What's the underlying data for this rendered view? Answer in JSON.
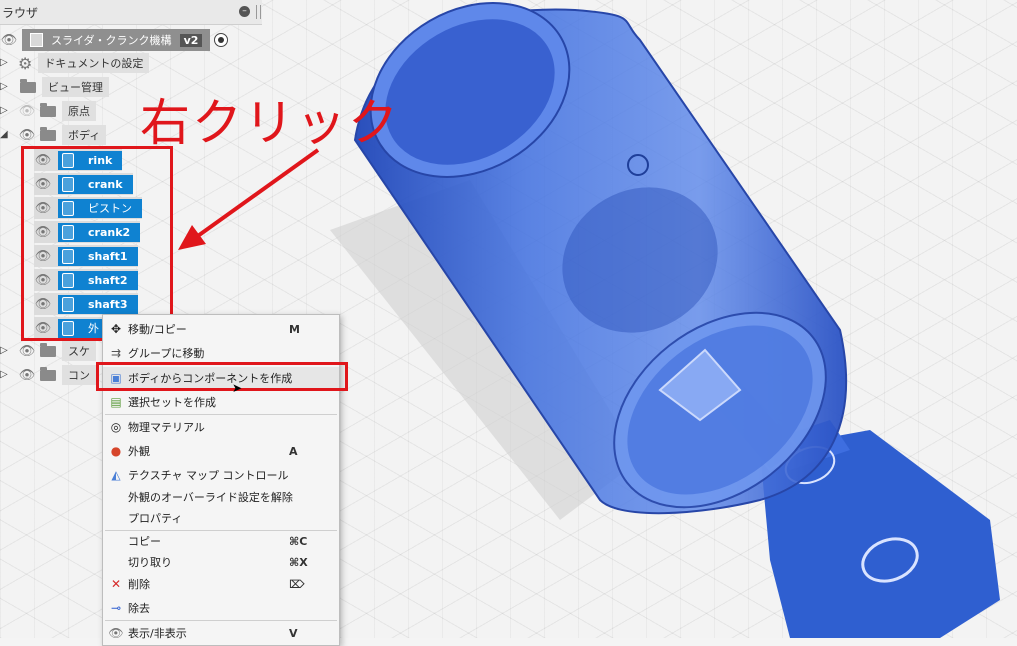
{
  "browser": {
    "title": "ラウザ",
    "minimize": "–",
    "document": {
      "name": "スライダ・クランク機構",
      "version": "v2"
    },
    "items": [
      {
        "label": "ドキュメントの設定"
      },
      {
        "label": "ビュー管理"
      },
      {
        "label": "原点"
      },
      {
        "label": "ボディ"
      }
    ],
    "bodies": [
      {
        "label": "rink"
      },
      {
        "label": "crank"
      },
      {
        "label": "ピストン"
      },
      {
        "label": "crank2"
      },
      {
        "label": "shaft1"
      },
      {
        "label": "shaft2"
      },
      {
        "label": "shaft3"
      },
      {
        "label": "外"
      }
    ],
    "bottom_items": [
      {
        "label": "スケ"
      },
      {
        "label": "コン"
      }
    ]
  },
  "annotation": {
    "text": "右クリック",
    "color": "#e0161b"
  },
  "context_menu": {
    "items": [
      {
        "label": "移動/コピー",
        "shortcut": "M",
        "icon": "move-icon"
      },
      {
        "label": "グループに移動",
        "shortcut": "",
        "icon": "group-move-icon"
      },
      {
        "label": "ボディからコンポーネントを作成",
        "shortcut": "",
        "icon": "create-component-icon"
      },
      {
        "label": "選択セットを作成",
        "shortcut": "",
        "icon": "selection-set-icon"
      },
      {
        "label": "物理マテリアル",
        "shortcut": "",
        "icon": "physical-material-icon"
      },
      {
        "label": "外観",
        "shortcut": "A",
        "icon": "appearance-icon"
      },
      {
        "label": "テクスチャ マップ コントロール",
        "shortcut": "",
        "icon": "texture-map-icon"
      },
      {
        "label": "外観のオーバーライド設定を解除",
        "shortcut": ""
      },
      {
        "label": "プロパティ",
        "shortcut": ""
      },
      {
        "label": "コピー",
        "shortcut": "⌘C"
      },
      {
        "label": "切り取り",
        "shortcut": "⌘X"
      },
      {
        "label": "削除",
        "shortcut": "⌦",
        "icon": "delete-icon"
      },
      {
        "label": "除去",
        "shortcut": "",
        "icon": "remove-icon"
      },
      {
        "label": "表示/非表示",
        "shortcut": "V",
        "icon": "visibility-icon"
      }
    ]
  },
  "colors": {
    "accent": "#0f82d1",
    "model_blue": "#2f5fd0",
    "annotation_red": "#e0161b"
  }
}
